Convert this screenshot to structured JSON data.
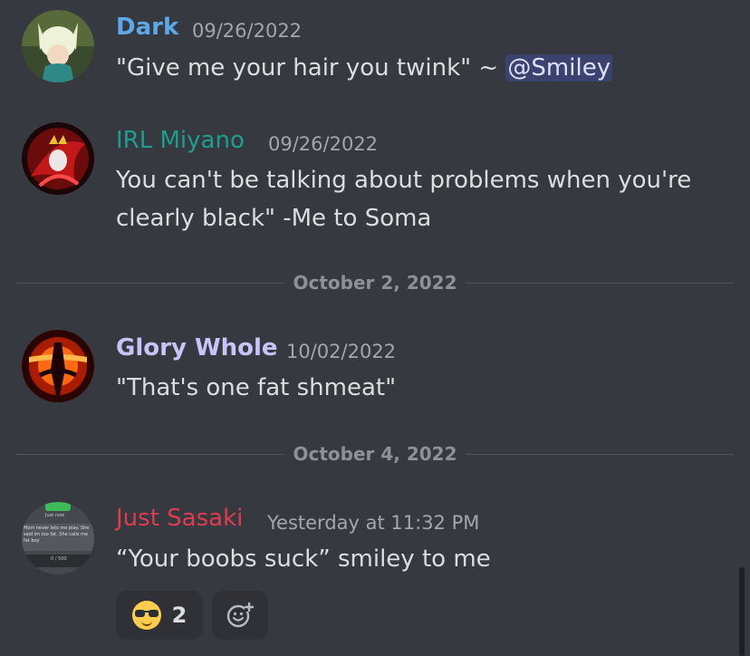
{
  "messages": [
    {
      "username": "Dark",
      "username_color": "#5da8e8",
      "timestamp": "09/26/2022",
      "text_before": "\"Give me your hair you twink\" ~ ",
      "mention": "@Smiley"
    },
    {
      "username": "IRL Miyano",
      "username_color": "#1e9e8e",
      "timestamp": "09/26/2022",
      "text": "You can't be talking about problems when you're clearly black\" -Me to Soma"
    },
    {
      "username": "Glory Whole",
      "username_color": "#c9c4f7",
      "timestamp": "10/02/2022",
      "text": "\"That's one fat shmeat\""
    },
    {
      "username": "Just Sasaki",
      "username_color": "#e03b4f",
      "timestamp": "Yesterday at 11:32 PM",
      "text": "“Your boobs suck” smiley to me",
      "reaction": {
        "emoji": "sunglasses-emoji",
        "count": "2"
      }
    }
  ],
  "dividers": [
    {
      "date": "October 2, 2022"
    },
    {
      "date": "October 4, 2022"
    }
  ],
  "avatar_thumbnail_text": {
    "top": "Just now",
    "middle": "Mom never lets me play. She said im too fat. She calls me fat boy",
    "bottom": "0 / 500"
  },
  "icons": {
    "add_reaction": "add-reaction-icon"
  }
}
